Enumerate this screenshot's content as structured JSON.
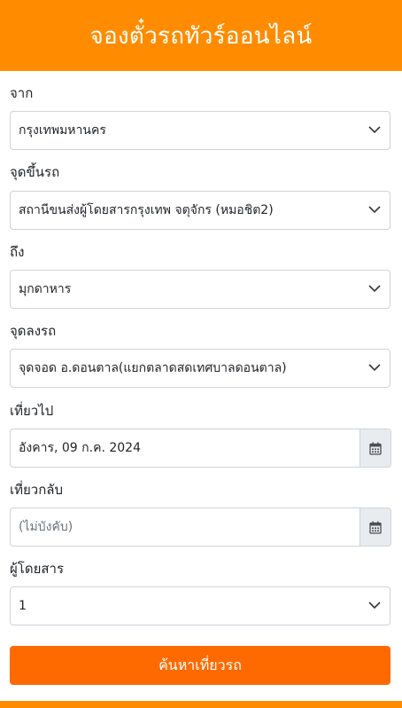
{
  "header": {
    "title": "จองตั๋วรถทัวร์ออนไลน์"
  },
  "form": {
    "origin": {
      "label": "จาก",
      "value": "กรุงเทพมหานคร"
    },
    "boarding_point": {
      "label": "จุดขึ้นรถ",
      "value": "สถานีขนส่งผู้โดยสารกรุงเทพ จตุจักร (หมอชิต2)"
    },
    "destination": {
      "label": "ถึง",
      "value": "มุกดาหาร"
    },
    "dropoff_point": {
      "label": "จุดลงรถ",
      "value": "จุดจอด อ.ดอนตาล(แยกตลาดสดเทศบาลดอนตาล)"
    },
    "departure": {
      "label": "เที่ยวไป",
      "value": "อังคาร, 09 ก.ค. 2024"
    },
    "return": {
      "label": "เที่ยวกลับ",
      "placeholder": "(ไม่บังคับ)"
    },
    "passengers": {
      "label": "ผู้โดยสาร",
      "value": "1"
    },
    "submit_label": "ค้นหาเที่ยวรถ"
  },
  "colors": {
    "brand": "#ff8c00",
    "button": "#ff6a00"
  },
  "icons": {
    "dropdown": "chevron-down-icon",
    "calendar": "calendar-icon"
  }
}
